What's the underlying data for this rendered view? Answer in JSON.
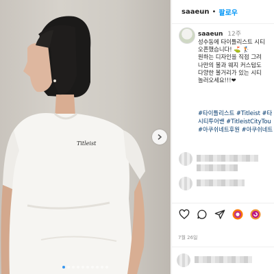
{
  "header": {
    "username": "saaeun",
    "separator": "•",
    "follow_label": "팔로우"
  },
  "post": {
    "username": "saaeun",
    "time_ago": "12주",
    "caption_lines": [
      "성수동에 타이틀리스트 시티",
      "오픈했습니다! ⛳ 🏌",
      "원하는 디자인을 직접 그려",
      "나만의 볼과 웨지 커스텀도",
      "다양한 볼거리가 있는 시티",
      "놀러오세요!!!❤"
    ],
    "hashtag_lines": [
      "#타이틀리스트 #Titleist #타",
      "시티투어밴 #TitleistCityTou",
      "#아쿠쉬네트후원 #아쿠쉬네트"
    ]
  },
  "photo": {
    "shirt_logo_text": "Titleist"
  },
  "carousel": {
    "total": 10,
    "active_index": 0
  },
  "actions": [
    "heart-icon",
    "comment-icon",
    "share-icon",
    "reel-icon",
    "reel-alt-icon"
  ],
  "date": "7월 26일",
  "colors": {
    "accent": "#0095f6",
    "hashtag": "#00376b",
    "muted": "#8e8e8e"
  }
}
